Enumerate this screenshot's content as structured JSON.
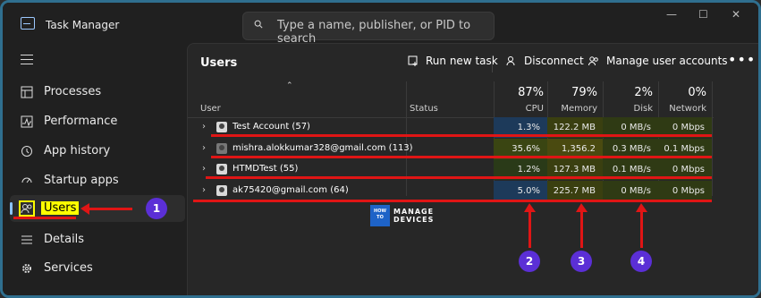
{
  "window": {
    "title": "Task Manager",
    "controls": [
      "minimize-icon",
      "maximize-icon",
      "close-icon"
    ]
  },
  "search": {
    "placeholder": "Type a name, publisher, or PID to search"
  },
  "sidebar": {
    "items": [
      {
        "label": "Processes",
        "icon": "processes-icon"
      },
      {
        "label": "Performance",
        "icon": "performance-icon"
      },
      {
        "label": "App history",
        "icon": "app-history-icon"
      },
      {
        "label": "Startup apps",
        "icon": "startup-icon"
      },
      {
        "label": "Users",
        "icon": "users-icon",
        "active": true
      },
      {
        "label": "Details",
        "icon": "details-icon"
      },
      {
        "label": "Services",
        "icon": "services-icon"
      }
    ]
  },
  "page": {
    "title": "Users"
  },
  "toolbar": {
    "run_new_task": "Run new task",
    "disconnect": "Disconnect",
    "manage_user_accounts": "Manage user accounts",
    "more": "•••"
  },
  "table": {
    "columns": {
      "user": "User",
      "status": "Status",
      "cpu": {
        "label": "CPU",
        "percent": "87%"
      },
      "memory": {
        "label": "Memory",
        "percent": "79%"
      },
      "disk": {
        "label": "Disk",
        "percent": "2%"
      },
      "network": {
        "label": "Network",
        "percent": "0%"
      }
    },
    "rows": [
      {
        "name": "Test Account (57)",
        "cpu": "1.3%",
        "memory": "122.2 MB",
        "disk": "0 MB/s",
        "network": "0 Mbps"
      },
      {
        "name": "mishra.alokkumar328@gmail.com (113)",
        "cpu": "35.6%",
        "memory": "1,356.2 MB",
        "disk": "0.3 MB/s",
        "network": "0.1 Mbps"
      },
      {
        "name": "HTMDTest (55)",
        "cpu": "1.2%",
        "memory": "127.3 MB",
        "disk": "0.1 MB/s",
        "network": "0 Mbps"
      },
      {
        "name": "ak75420@gmail.com (64)",
        "cpu": "5.0%",
        "memory": "225.7 MB",
        "disk": "0 MB/s",
        "network": "0 Mbps"
      }
    ]
  },
  "annotations": {
    "badges": [
      "1",
      "2",
      "3",
      "4"
    ]
  },
  "watermark": {
    "how_to": "HOW TO",
    "line1": "MANAGE",
    "line2": "DEVICES"
  },
  "colors": {
    "accent": "#8ac4ff",
    "highlight": "#ffff00",
    "annotation_red": "#e01515",
    "badge": "#5b2fd6"
  }
}
